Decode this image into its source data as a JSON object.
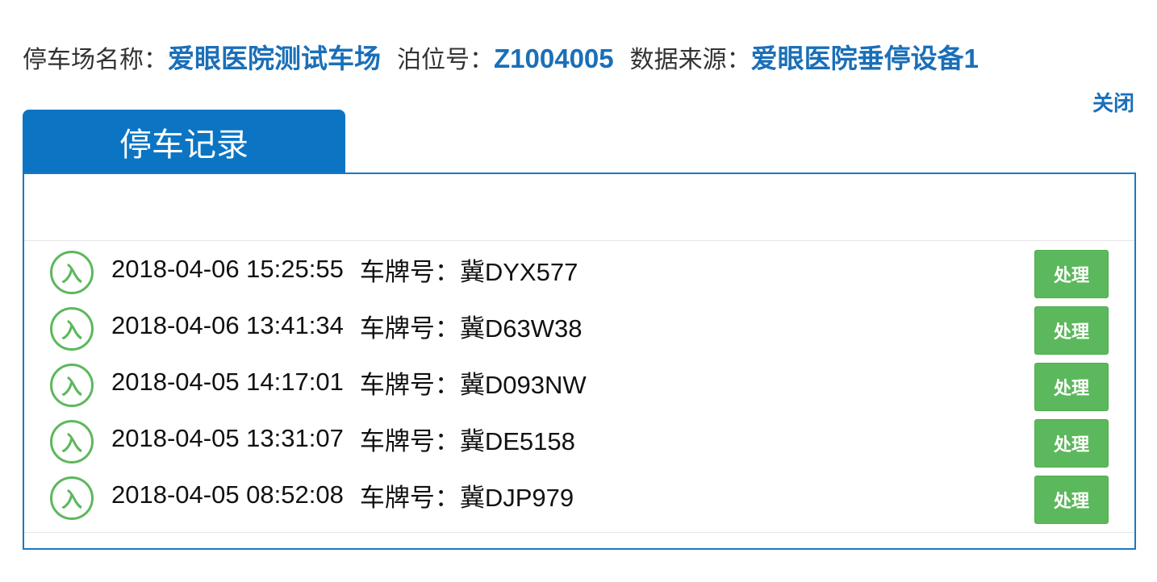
{
  "header": {
    "lot_label": "停车场名称：",
    "lot_value": "爱眼医院测试车场",
    "berth_label": "泊位号：",
    "berth_value": "Z1004005",
    "source_label": "数据来源：",
    "source_value": "爱眼医院垂停设备1",
    "close_label": "关闭"
  },
  "tab": {
    "label": "停车记录"
  },
  "records": [
    {
      "direction": "入",
      "time": "2018-04-06 15:25:55",
      "plate_label": "车牌号：",
      "plate": "冀DYX577",
      "action": "处理"
    },
    {
      "direction": "入",
      "time": "2018-04-06 13:41:34",
      "plate_label": "车牌号：",
      "plate": "冀D63W38",
      "action": "处理"
    },
    {
      "direction": "入",
      "time": "2018-04-05 14:17:01",
      "plate_label": "车牌号：",
      "plate": "冀D093NW",
      "action": "处理"
    },
    {
      "direction": "入",
      "time": "2018-04-05 13:31:07",
      "plate_label": "车牌号：",
      "plate": "冀DE5158",
      "action": "处理"
    },
    {
      "direction": "入",
      "time": "2018-04-05 08:52:08",
      "plate_label": "车牌号：",
      "plate": "冀DJP979",
      "action": "处理"
    }
  ],
  "colors": {
    "accent": "#0b75c4",
    "link": "#1a6fb8",
    "success": "#5cb85c"
  }
}
